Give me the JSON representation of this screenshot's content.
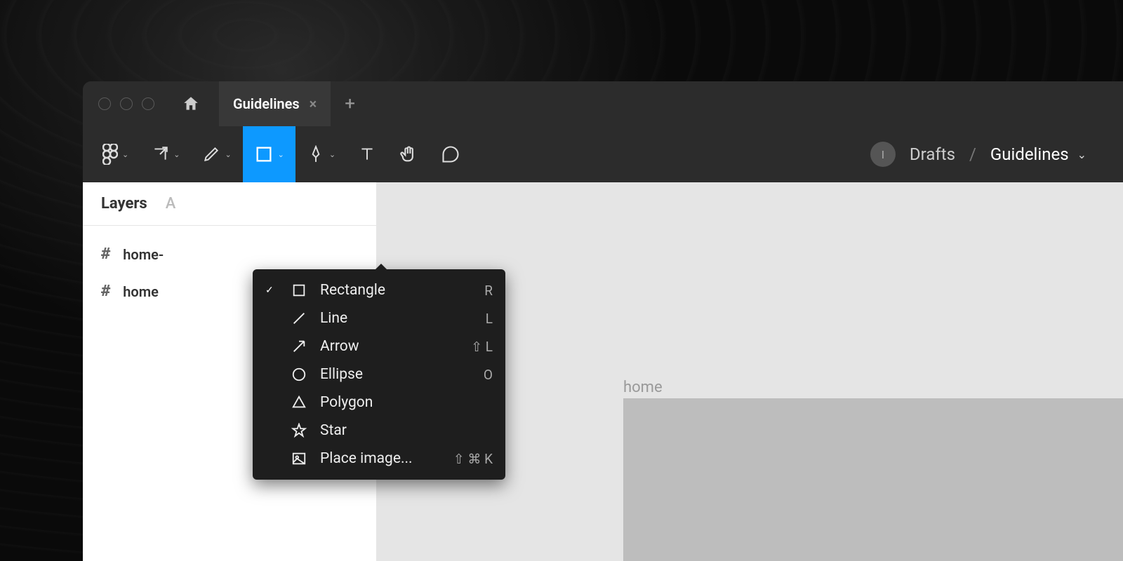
{
  "titlebar": {
    "tab_label": "Guidelines"
  },
  "breadcrumb": {
    "avatar_initial": "I",
    "folder": "Drafts",
    "file": "Guidelines"
  },
  "sidebar": {
    "tabs": {
      "layers": "Layers",
      "assets": "A"
    },
    "layers": [
      {
        "label": "home-"
      },
      {
        "label": "home"
      }
    ]
  },
  "canvas": {
    "frame_label": "home"
  },
  "shape_menu": {
    "items": [
      {
        "label": "Rectangle",
        "shortcut": "R",
        "checked": true,
        "icon": "rectangle"
      },
      {
        "label": "Line",
        "shortcut": "L",
        "checked": false,
        "icon": "line"
      },
      {
        "label": "Arrow",
        "shortcut": "⇧ L",
        "checked": false,
        "icon": "arrow"
      },
      {
        "label": "Ellipse",
        "shortcut": "O",
        "checked": false,
        "icon": "ellipse"
      },
      {
        "label": "Polygon",
        "shortcut": "",
        "checked": false,
        "icon": "polygon"
      },
      {
        "label": "Star",
        "shortcut": "",
        "checked": false,
        "icon": "star"
      },
      {
        "label": "Place image...",
        "shortcut": "⇧ ⌘ K",
        "checked": false,
        "icon": "image"
      }
    ]
  }
}
